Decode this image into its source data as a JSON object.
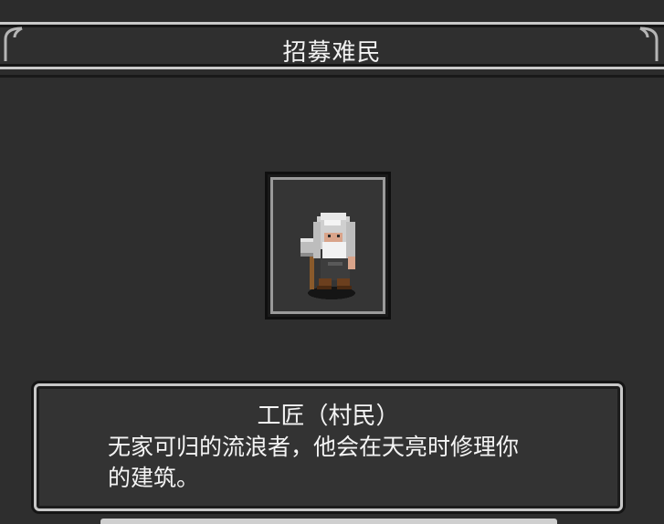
{
  "header": {
    "title": "招募难民"
  },
  "recruit": {
    "portrait_icon": "dwarf-craftsman-sprite",
    "name": "工匠（村民）",
    "description": "无家可归的流浪者，他会在天亮时修理你的建筑。"
  },
  "colors": {
    "background": "#2c2c2c",
    "frame": "#c9c9c9",
    "text": "#f2f2f2"
  }
}
